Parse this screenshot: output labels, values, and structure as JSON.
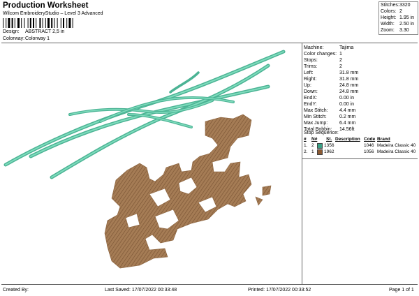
{
  "header": {
    "title": "Production Worksheet",
    "subtitle": "Wilcom EmbroideryStudio – Level 3 Advanced",
    "design_label": "Design:",
    "design_value": "ABSTRACT 2,5 in",
    "colorway_label": "Colorway:",
    "colorway_value": "Colorway 1"
  },
  "top_stats": [
    {
      "label": "Stitches:",
      "value": "3320"
    },
    {
      "label": "Colors:",
      "value": "2"
    },
    {
      "label": "Height:",
      "value": "1.95 in"
    },
    {
      "label": "Width:",
      "value": "2.50 in"
    },
    {
      "label": "Zoom:",
      "value": "3.30"
    }
  ],
  "details": [
    {
      "label": "Machine:",
      "value": "Tajima"
    },
    {
      "label": "Color changes:",
      "value": "1"
    },
    {
      "label": "Stops:",
      "value": "2"
    },
    {
      "label": "Trims:",
      "value": "2"
    },
    {
      "label": "Left:",
      "value": "31.8 mm"
    },
    {
      "label": "Right:",
      "value": "31.8 mm"
    },
    {
      "label": "Up:",
      "value": "24.8 mm"
    },
    {
      "label": "Down:",
      "value": "24.8 mm"
    },
    {
      "label": "EndX:",
      "value": "0.00 in"
    },
    {
      "label": "EndY:",
      "value": "0.00 in"
    },
    {
      "label": "Max Stitch:",
      "value": "4.4 mm"
    },
    {
      "label": "Min Stitch:",
      "value": "0.2 mm"
    },
    {
      "label": "Max Jump:",
      "value": "6.4 mm"
    },
    {
      "label": "Total Bobbin:",
      "value": "14.56ft"
    }
  ],
  "stop_sequence": {
    "title": "Stop Sequence:",
    "headers": {
      "num": "#",
      "n": "N#",
      "st": "St.",
      "description": "Description",
      "code": "Code",
      "brand": "Brand"
    },
    "rows": [
      {
        "num": "1.",
        "n": "2",
        "color": "#3aa186",
        "st": "1356",
        "description": "",
        "code": "1046",
        "brand": "Madeira Classic 40"
      },
      {
        "num": "2.",
        "n": "1",
        "color": "#8b5a33",
        "st": "1962",
        "description": "",
        "code": "1056",
        "brand": "Madeira Classic 40"
      }
    ]
  },
  "footer": {
    "created_by": "Created By:",
    "last_saved": "Last Saved: 17/07/2022 00:33:48",
    "printed": "Printed: 17/07/2022 00:33:52",
    "page": "Page 1 of 1"
  },
  "colors": {
    "thread_1": "#62c8a6",
    "thread_2": "#a57c55"
  }
}
